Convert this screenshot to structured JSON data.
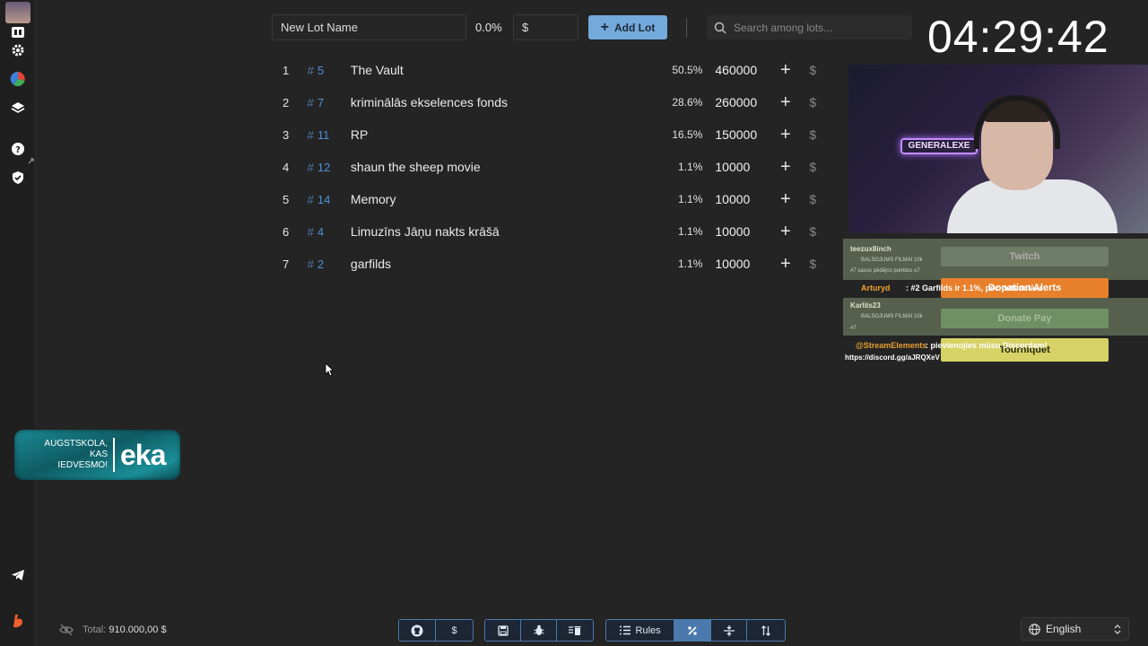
{
  "controls": {
    "lot_name_placeholder": "New Lot Name",
    "percent_value": "0.0%",
    "amount_placeholder": "$",
    "add_lot_label": "Add Lot",
    "search_placeholder": "Search among lots..."
  },
  "timer": "04:29:42",
  "lots": [
    {
      "rank": "1",
      "id": "5",
      "name": "The Vault",
      "percent": "50.5%",
      "amount": "460000"
    },
    {
      "rank": "2",
      "id": "7",
      "name": "kriminālās ekselences fonds",
      "percent": "28.6%",
      "amount": "260000"
    },
    {
      "rank": "3",
      "id": "11",
      "name": "RP",
      "percent": "16.5%",
      "amount": "150000"
    },
    {
      "rank": "4",
      "id": "12",
      "name": "shaun the sheep movie",
      "percent": "1.1%",
      "amount": "10000"
    },
    {
      "rank": "5",
      "id": "14",
      "name": "Memory",
      "percent": "1.1%",
      "amount": "10000"
    },
    {
      "rank": "6",
      "id": "4",
      "name": "Limuzīns Jāņu nakts krāšā",
      "percent": "1.1%",
      "amount": "10000"
    },
    {
      "rank": "7",
      "id": "2",
      "name": "garfilds",
      "percent": "1.1%",
      "amount": "10000"
    }
  ],
  "lot_hash": "#",
  "lot_plus": "+",
  "lot_dollar": "$",
  "stream_overlay": {
    "cam_sign": "GENERALEXE",
    "chat": {
      "user1": "teezux8inch",
      "user1_badge": "BALSOJUMS FILMAI 10k",
      "user1_msg": "#7 savus pēdējos punktus o7",
      "user2": "Arturyd",
      "user2_msg": ": #2 Garfilds ir 1.1%, pēc potenciālu",
      "user3": "Karlits23",
      "user3_badge": "BALSOJUMS FILMAI 10k",
      "user3_msg": "#7",
      "user4": "@StreamElements",
      "user4_msg": ": pievienojies mūsu Discordam!",
      "link": "https://discord.gg/aJRQXeV"
    },
    "buttons": {
      "twitch": "Twitch",
      "donation_alerts": "Donation Alerts",
      "donate_pay": "Donate Pay",
      "tourniquet": "Tourniquet"
    }
  },
  "sponsor": {
    "line1": "AUGSTSKOLA, KAS",
    "line2": "IEDVESMO!",
    "logo": "eka"
  },
  "footer": {
    "total_label": "Total:",
    "total_value": "910.000,00 $",
    "rules_label": "Rules",
    "dollar_label": "$",
    "language": "English"
  },
  "colors": {
    "accent": "#74a9dc",
    "background": "#242424",
    "link_blue": "#4f8fd6"
  }
}
